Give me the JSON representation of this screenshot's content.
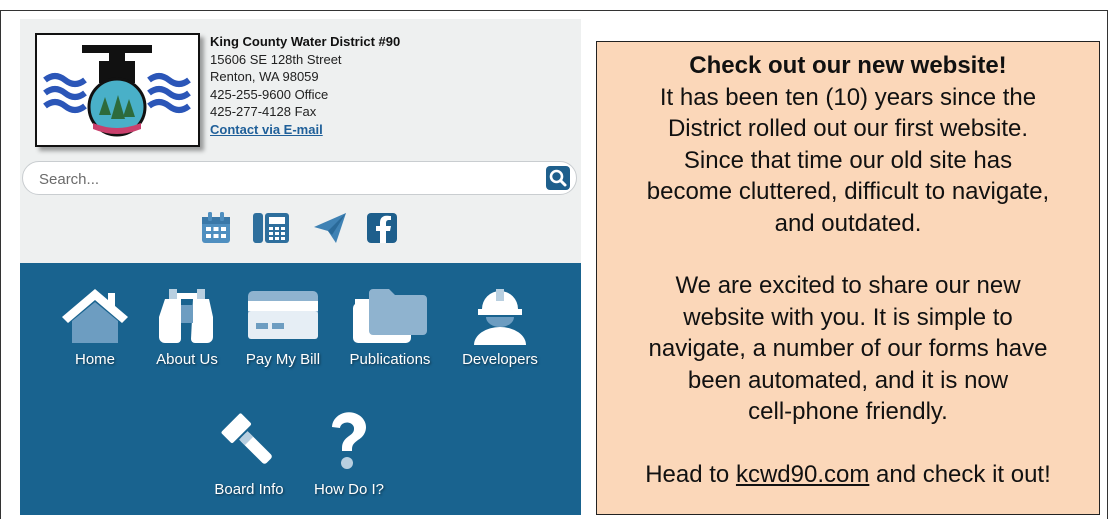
{
  "district": {
    "name": "King County Water District #90",
    "address_line1": "15606 SE 128th Street",
    "address_line2": "Renton, WA 98059",
    "office_phone": "425-255-9600 Office",
    "fax": "425-277-4128 Fax",
    "contact_link": "Contact via E-mail"
  },
  "search": {
    "placeholder": "Search..."
  },
  "social": [
    "calendar-icon",
    "phone-fax-icon",
    "send-icon",
    "facebook-icon"
  ],
  "nav": {
    "home": "Home",
    "about": "About Us",
    "pay": "Pay My Bill",
    "publications": "Publications",
    "developers": "Developers",
    "board": "Board Info",
    "howdoi": "How Do I?"
  },
  "notice": {
    "headline": "Check out our new website!",
    "para1": [
      "It has been ten (10) years since the",
      "District rolled out our first website.",
      "Since that time our old site has",
      "become cluttered, difficult to navigate,",
      "and outdated."
    ],
    "para2": [
      "We are excited to share our new",
      "website with you. It is simple to",
      "navigate, a number of our forms have",
      "been automated, and it is now",
      "cell-phone friendly."
    ],
    "cta_prefix": "Head to ",
    "cta_link": "kcwd90.com",
    "cta_suffix": " and check it out!"
  },
  "colors": {
    "nav_bg": "#19638f",
    "notice_bg": "#fbd7b9",
    "link": "#1f5f99"
  }
}
